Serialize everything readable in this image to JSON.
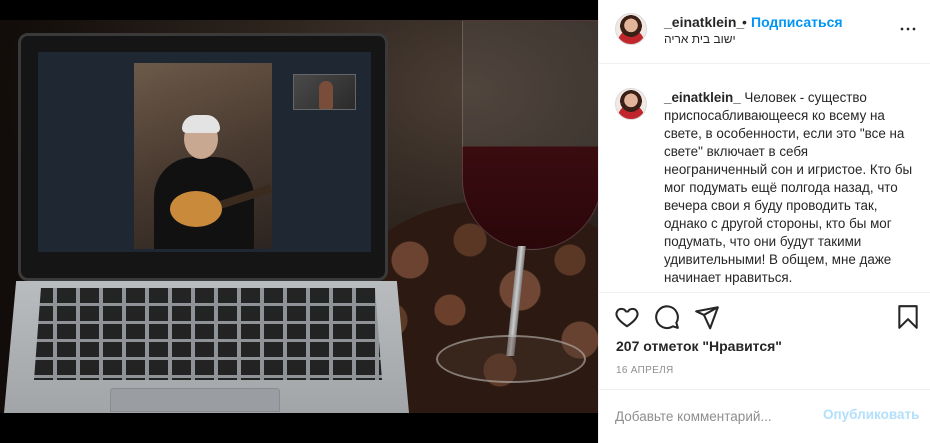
{
  "post": {
    "author": "_einatklein_",
    "separator": "•",
    "follow_label": "Подписаться",
    "location": "ישוב בית אריה",
    "caption_user": "_einatklein_",
    "caption_text": " Человек - существо приспосабливающееся ко всему на свете, в особенности, если это \"все на свете\" включает в себя неограниченный сон и игристое. Кто бы мог подумать ещё полгода назад, что вечера свои я буду проводить так, однако с другой стороны, кто бы мог подумать, что они будут такими удивительными! В общем, мне даже начинает нравиться.",
    "likes": "207 отметок \"Нравится\"",
    "date": "16 АПРЕЛЯ"
  },
  "comment": {
    "placeholder": "Добавьте комментарий...",
    "publish_label": "Опубликовать"
  },
  "icons": {
    "more": "more-options-icon",
    "like": "heart-icon",
    "comment": "comment-icon",
    "share": "share-icon",
    "save": "bookmark-icon"
  },
  "colors": {
    "link": "#0095f6",
    "publish_disabled": "#b2dffc",
    "muted": "#8e8e8e",
    "text": "#262626"
  }
}
